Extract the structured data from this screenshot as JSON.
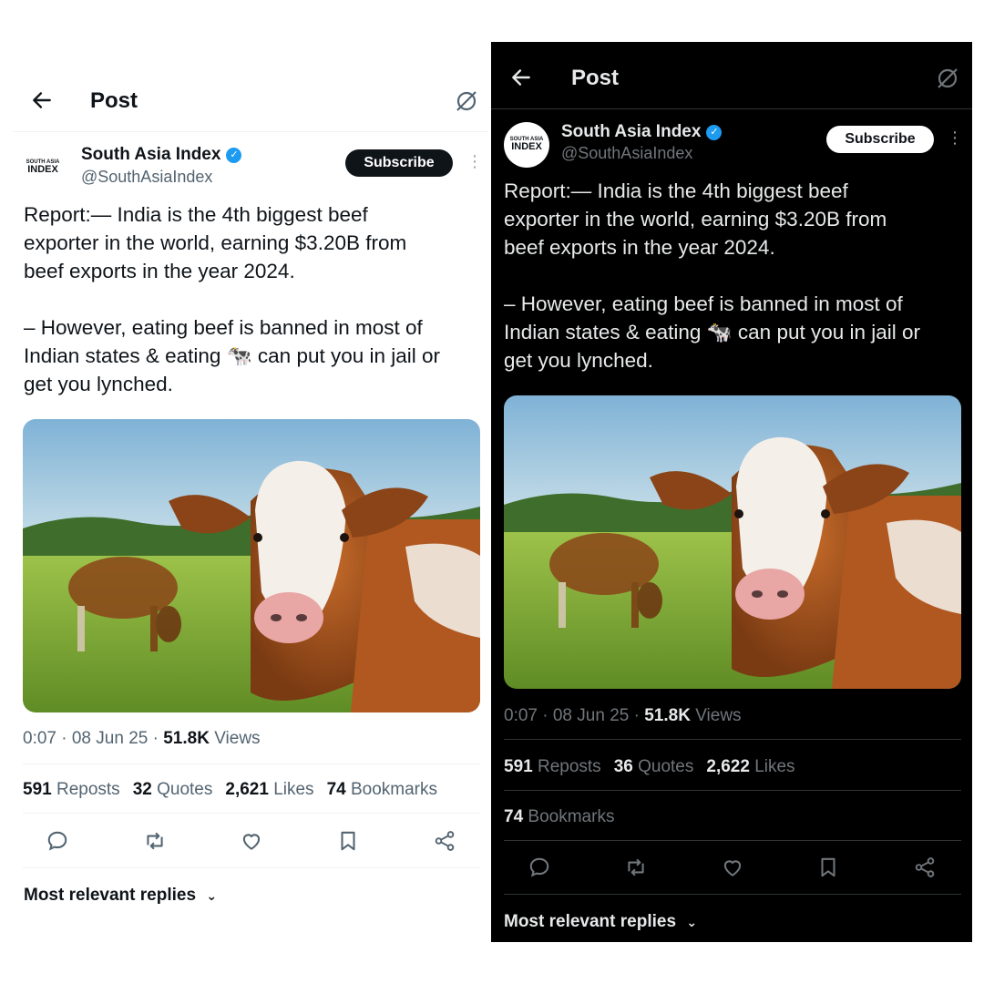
{
  "header": {
    "back_icon": "arrow-left-icon",
    "title": "Post",
    "grok_icon": "grok-icon"
  },
  "author": {
    "name": "South Asia Index",
    "handle": "@SouthAsiaIndex",
    "verified_icon": "verified-badge-icon",
    "avatar_text_small": "SOUTH ASIA",
    "avatar_text_big": "INDEX"
  },
  "subscribe_label": "Subscribe",
  "more_icon": "more-vertical-icon",
  "tweet": {
    "text": "Report:— India is the 4th biggest beef\nexporter in the world, earning $3.20B from\nbeef exports in the year 2024.\n\n– However, eating beef is banned in most of\nIndian states & eating 🐄 can put you in jail or\nget you lynched.",
    "media_description": ""
  },
  "light": {
    "time": "0:07 · 08 Jun 25 · ",
    "views_count": "51.8K",
    "views_label": " Views",
    "reposts_count": "591",
    "reposts_label": " Reposts",
    "quotes_count": "32",
    "quotes_label": " Quotes",
    "likes_count": "2,621",
    "likes_label": " Likes",
    "bookmarks_count": "74",
    "bookmarks_label": " Bookmarks"
  },
  "dark": {
    "time": "0:07 · 08 Jun 25 · ",
    "views_count": "51.8K",
    "views_label": " Views",
    "reposts_count": "591",
    "reposts_label": " Reposts",
    "quotes_count": "36",
    "quotes_label": " Quotes",
    "likes_count": "2,622",
    "likes_label": " Likes",
    "bookmarks_count": "74",
    "bookmarks_label": " Bookmarks"
  },
  "actions": [
    "reply-icon",
    "repost-icon",
    "like-icon",
    "bookmark-icon",
    "share-icon"
  ],
  "replies_label": "Most relevant replies",
  "colors": {
    "accent": "#1d9bf0",
    "light_bg": "#ffffff",
    "dark_bg": "#000000"
  }
}
